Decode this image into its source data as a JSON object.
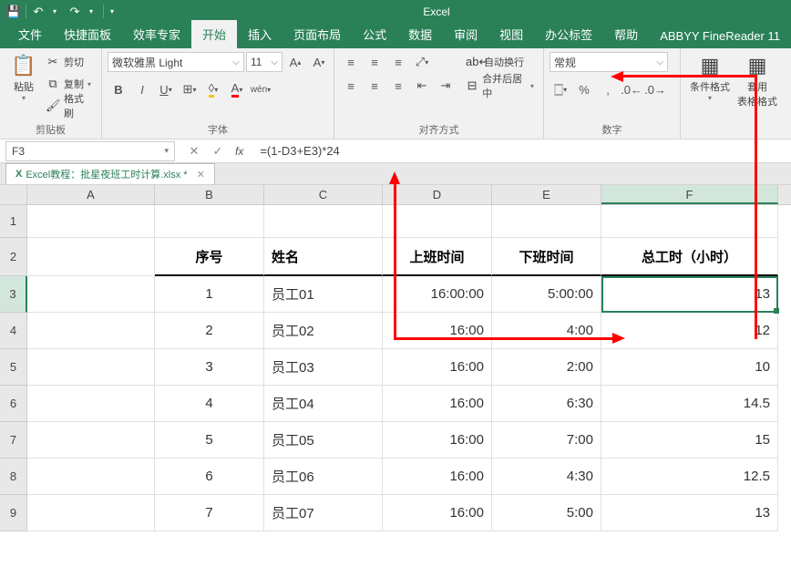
{
  "app_title": "Excel",
  "tabs": [
    "文件",
    "快捷面板",
    "效率专家",
    "开始",
    "插入",
    "页面布局",
    "公式",
    "数据",
    "审阅",
    "视图",
    "办公标签",
    "帮助",
    "ABBYY FineReader 11"
  ],
  "active_tab_index": 3,
  "ribbon": {
    "clipboard": {
      "paste": "粘贴",
      "cut": "剪切",
      "copy": "复制",
      "format_painter": "格式刷",
      "group_label": "剪贴板"
    },
    "font": {
      "name": "微软雅黑 Light",
      "size": "11",
      "group_label": "字体"
    },
    "align": {
      "wrap": "自动换行",
      "merge": "合并后居中",
      "group_label": "对齐方式"
    },
    "number": {
      "format": "常规",
      "group_label": "数字"
    },
    "styles": {
      "cond": "条件格式",
      "tablefmt": "套用\n表格格式"
    }
  },
  "name_box": "F3",
  "formula": "=(1-D3+E3)*24",
  "workbook_tab": "Excel教程：批星夜班工时计算.xlsx *",
  "columns": [
    "A",
    "B",
    "C",
    "D",
    "E",
    "F"
  ],
  "selected_col_index": 5,
  "row_numbers": [
    1,
    2,
    3,
    4,
    5,
    6,
    7,
    8,
    9
  ],
  "selected_row_index": 2,
  "header_row": {
    "B": "序号",
    "C": "姓名",
    "D": "上班时间",
    "E": "下班时间",
    "F": "总工时（小时）"
  },
  "data_rows": [
    {
      "B": "1",
      "C": "员工01",
      "D": "16:00:00",
      "E": "5:00:00",
      "F": "13"
    },
    {
      "B": "2",
      "C": "员工02",
      "D": "16:00",
      "E": "4:00",
      "F": "12"
    },
    {
      "B": "3",
      "C": "员工03",
      "D": "16:00",
      "E": "2:00",
      "F": "10"
    },
    {
      "B": "4",
      "C": "员工04",
      "D": "16:00",
      "E": "6:30",
      "F": "14.5"
    },
    {
      "B": "5",
      "C": "员工05",
      "D": "16:00",
      "E": "7:00",
      "F": "15"
    },
    {
      "B": "6",
      "C": "员工06",
      "D": "16:00",
      "E": "4:30",
      "F": "12.5"
    },
    {
      "B": "7",
      "C": "员工07",
      "D": "16:00",
      "E": "5:00",
      "F": "13"
    }
  ]
}
